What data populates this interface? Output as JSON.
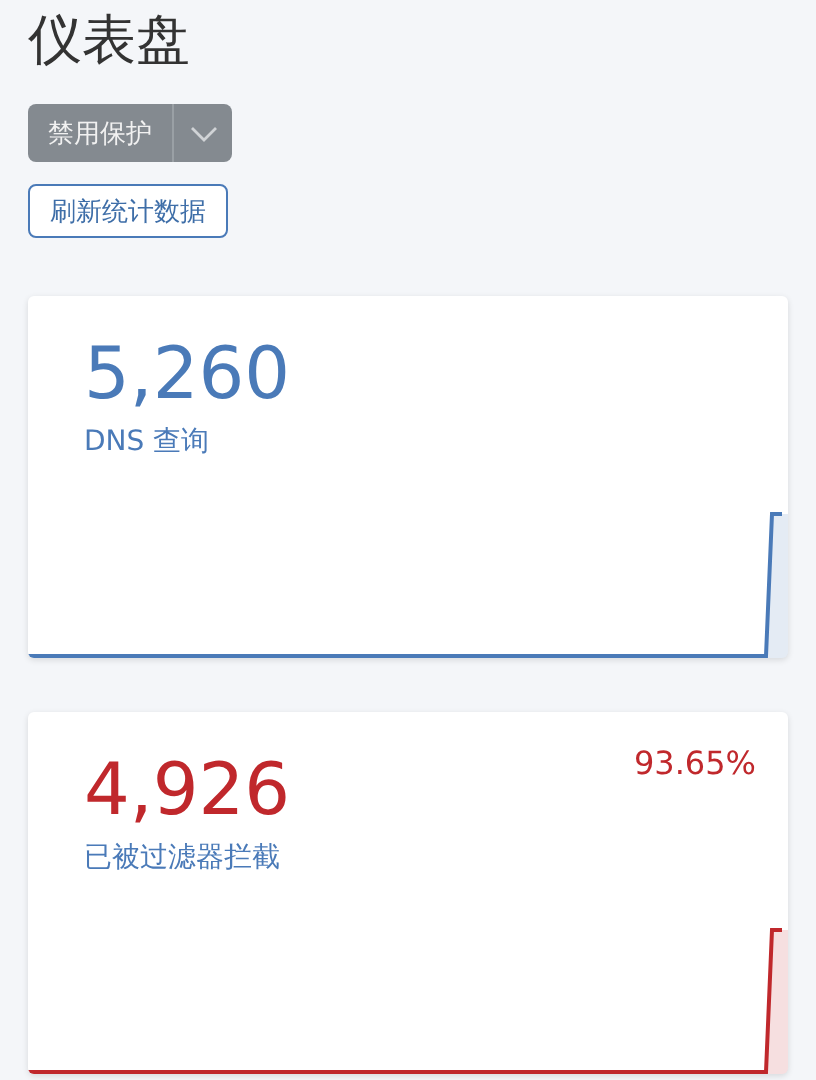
{
  "title": "仪表盘",
  "protection_button": {
    "label": "禁用保护"
  },
  "refresh_button": {
    "label": "刷新统计数据"
  },
  "cards": [
    {
      "value": "5,260",
      "label": "DNS 查询",
      "color": "#4a7ab8"
    },
    {
      "value": "4,926",
      "label": "已被过滤器拦截",
      "percent": "93.65%",
      "color": "#c0282c"
    }
  ]
}
